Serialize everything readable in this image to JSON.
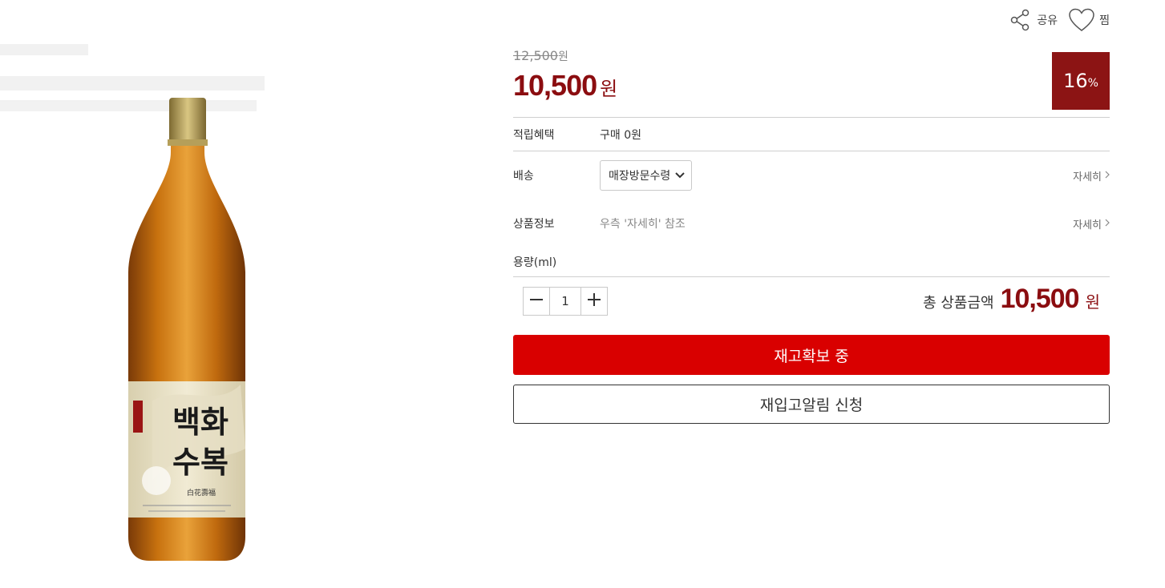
{
  "top_actions": {
    "share_label": "공유",
    "wish_label": "찜"
  },
  "price": {
    "original": "12,500",
    "original_unit": "원",
    "sale": "10,500",
    "sale_unit": "원",
    "discount_value": "16",
    "discount_unit": "%"
  },
  "info": {
    "points_label": "적립혜택",
    "points_value": "구매 0원",
    "shipping_label": "배송",
    "shipping_selected": "매장방문수령",
    "shipping_detail": "자세히",
    "product_info_label": "상품정보",
    "product_info_value": "우측 '자세히' 참조",
    "product_info_detail": "자세히",
    "volume_label": "용량(ml)"
  },
  "quantity": {
    "value": "1"
  },
  "total": {
    "label": "총 상품금액",
    "amount": "10,500",
    "unit": "원"
  },
  "buttons": {
    "primary": "재고확보 중",
    "secondary": "재입고알림 신청"
  },
  "product_label": {
    "name_line1": "백화",
    "name_line2": "수복",
    "hanja": "白花壽福"
  },
  "colors": {
    "accent": "#8b0d10",
    "button_red": "#d90000",
    "badge": "#8c1414"
  }
}
